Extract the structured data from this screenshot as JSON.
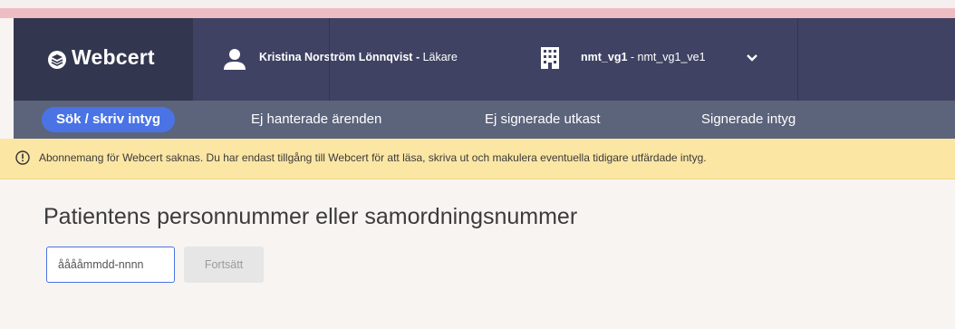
{
  "app": {
    "name": "Webcert"
  },
  "user": {
    "name": "Kristina Norström Lönnqvist",
    "role_separator": " - ",
    "role": "Läkare"
  },
  "unit": {
    "care_giver": "nmt_vg1",
    "separator": " - ",
    "care_unit": "nmt_vg1_ve1"
  },
  "nav": {
    "items": [
      {
        "label": "Sök / skriv intyg"
      },
      {
        "label": "Ej hanterade ärenden"
      },
      {
        "label": "Ej signerade utkast"
      },
      {
        "label": "Signerade intyg"
      }
    ]
  },
  "alert": {
    "text": "Abonnemang för Webcert saknas. Du har endast tillgång till Webcert för att läsa, skriva ut och makulera eventuella tidigare utfärdade intyg."
  },
  "main": {
    "heading": "Patientens personnummer eller samordningsnummer",
    "input": {
      "placeholder": "ååååmmdd-nnnn",
      "value": ""
    },
    "continue_label": "Fortsätt"
  },
  "colors": {
    "header": "#3f4263",
    "brand": "#33364f",
    "nav": "#5c647c",
    "accent": "#4a73e6",
    "alert": "#fbe6a4"
  }
}
